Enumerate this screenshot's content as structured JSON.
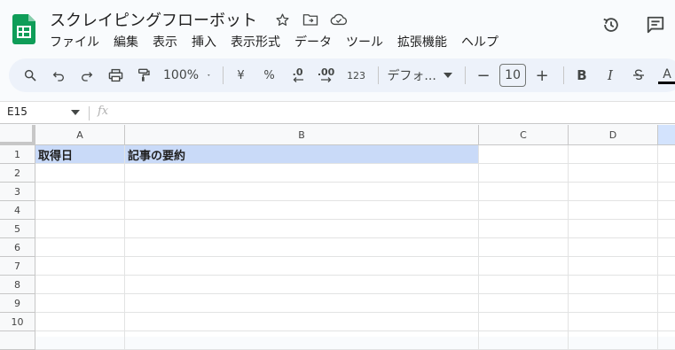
{
  "doc": {
    "title": "スクレイピングフローボット"
  },
  "menu": [
    "ファイル",
    "編集",
    "表示",
    "挿入",
    "表示形式",
    "データ",
    "ツール",
    "拡張機能",
    "ヘルプ"
  ],
  "toolbar": {
    "zoom": "100%",
    "currency": "¥",
    "percent": "%",
    "dec_decrease": ".0",
    "dec_increase": ".00",
    "number_format": "123",
    "font_name": "デフォ...",
    "font_size": "10",
    "bold": "B",
    "italic": "I",
    "text_color": "A"
  },
  "formula_bar": {
    "cell_ref": "E15",
    "fx": "fx",
    "value": ""
  },
  "columns": [
    "A",
    "B",
    "C",
    "D"
  ],
  "rows": [
    "1",
    "2",
    "3",
    "4",
    "5",
    "6",
    "7",
    "8",
    "9",
    "10"
  ],
  "cells": {
    "A1": "取得日",
    "B1": "記事の要約"
  },
  "colors": {
    "header_fill": "#c9daf8",
    "sheets_green": "#0f9d58",
    "toolbar_bg": "#edf2fa"
  }
}
